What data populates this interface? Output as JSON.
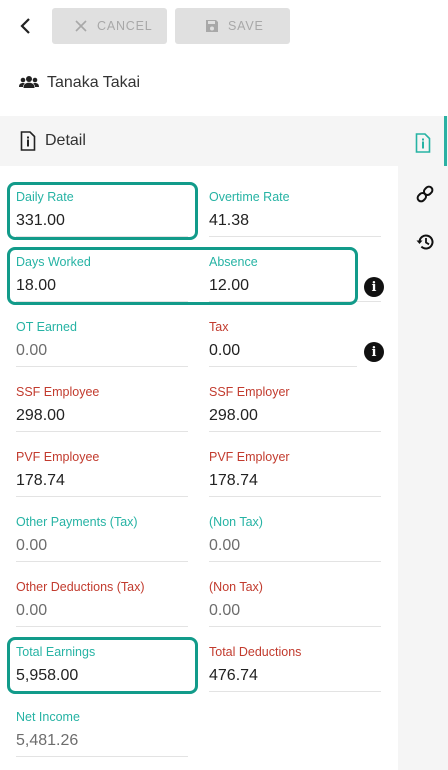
{
  "toolbar": {
    "cancel_label": "CANCEL",
    "save_label": "SAVE"
  },
  "user": {
    "name": "Tanaka Takai"
  },
  "section": {
    "title": "Detail"
  },
  "rail": {
    "icons": [
      "info-document-icon",
      "link-icon",
      "history-icon"
    ]
  },
  "fields": {
    "daily_rate": {
      "label": "Daily Rate",
      "value": "331.00"
    },
    "overtime_rate": {
      "label": "Overtime Rate",
      "value": "41.38"
    },
    "days_worked": {
      "label": "Days Worked",
      "value": "18.00"
    },
    "absence": {
      "label": "Absence",
      "value": "12.00"
    },
    "ot_earned": {
      "label": "OT Earned",
      "value": "0.00"
    },
    "tax": {
      "label": "Tax",
      "value": "0.00"
    },
    "ssf_employee": {
      "label": "SSF Employee",
      "value": "298.00"
    },
    "ssf_employer": {
      "label": "SSF Employer",
      "value": "298.00"
    },
    "pvf_employee": {
      "label": "PVF Employee",
      "value": "178.74"
    },
    "pvf_employer": {
      "label": "PVF Employer",
      "value": "178.74"
    },
    "other_payments_tax": {
      "label": "Other Payments (Tax)",
      "value": "0.00"
    },
    "other_payments_non_tax": {
      "label": "(Non Tax)",
      "value": "0.00"
    },
    "other_deductions_tax": {
      "label": "Other Deductions (Tax)",
      "value": "0.00"
    },
    "other_deductions_non_tax": {
      "label": "(Non Tax)",
      "value": "0.00"
    },
    "total_earnings": {
      "label": "Total Earnings",
      "value": "5,958.00"
    },
    "total_deductions": {
      "label": "Total Deductions",
      "value": "476.74"
    },
    "net_income": {
      "label": "Net Income",
      "value": "5,481.26"
    }
  },
  "colors": {
    "accent": "#26b3a4",
    "deduction": "#c23b2e",
    "highlight": "#129b8a"
  }
}
